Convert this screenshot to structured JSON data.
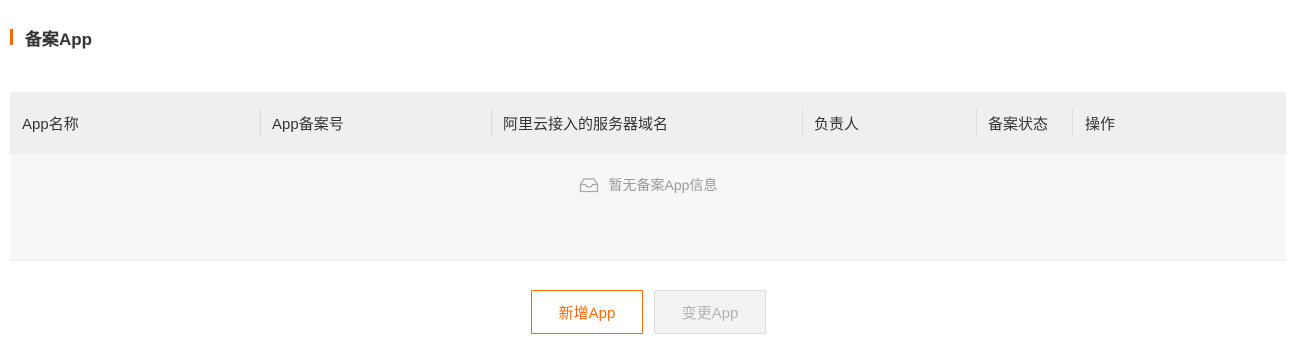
{
  "section": {
    "title": "备案App"
  },
  "table": {
    "columns": [
      "App名称",
      "App备案号",
      "阿里云接入的服务器域名",
      "负责人",
      "备案状态",
      "操作"
    ],
    "empty_text": "暂无备案App信息"
  },
  "actions": {
    "add_label": "新增App",
    "change_label": "变更App"
  },
  "colors": {
    "accent": "#ff6a00",
    "header_bg": "#efefef",
    "body_bg": "#f7f7f7"
  },
  "icons": {
    "empty": "empty-inbox-icon"
  }
}
